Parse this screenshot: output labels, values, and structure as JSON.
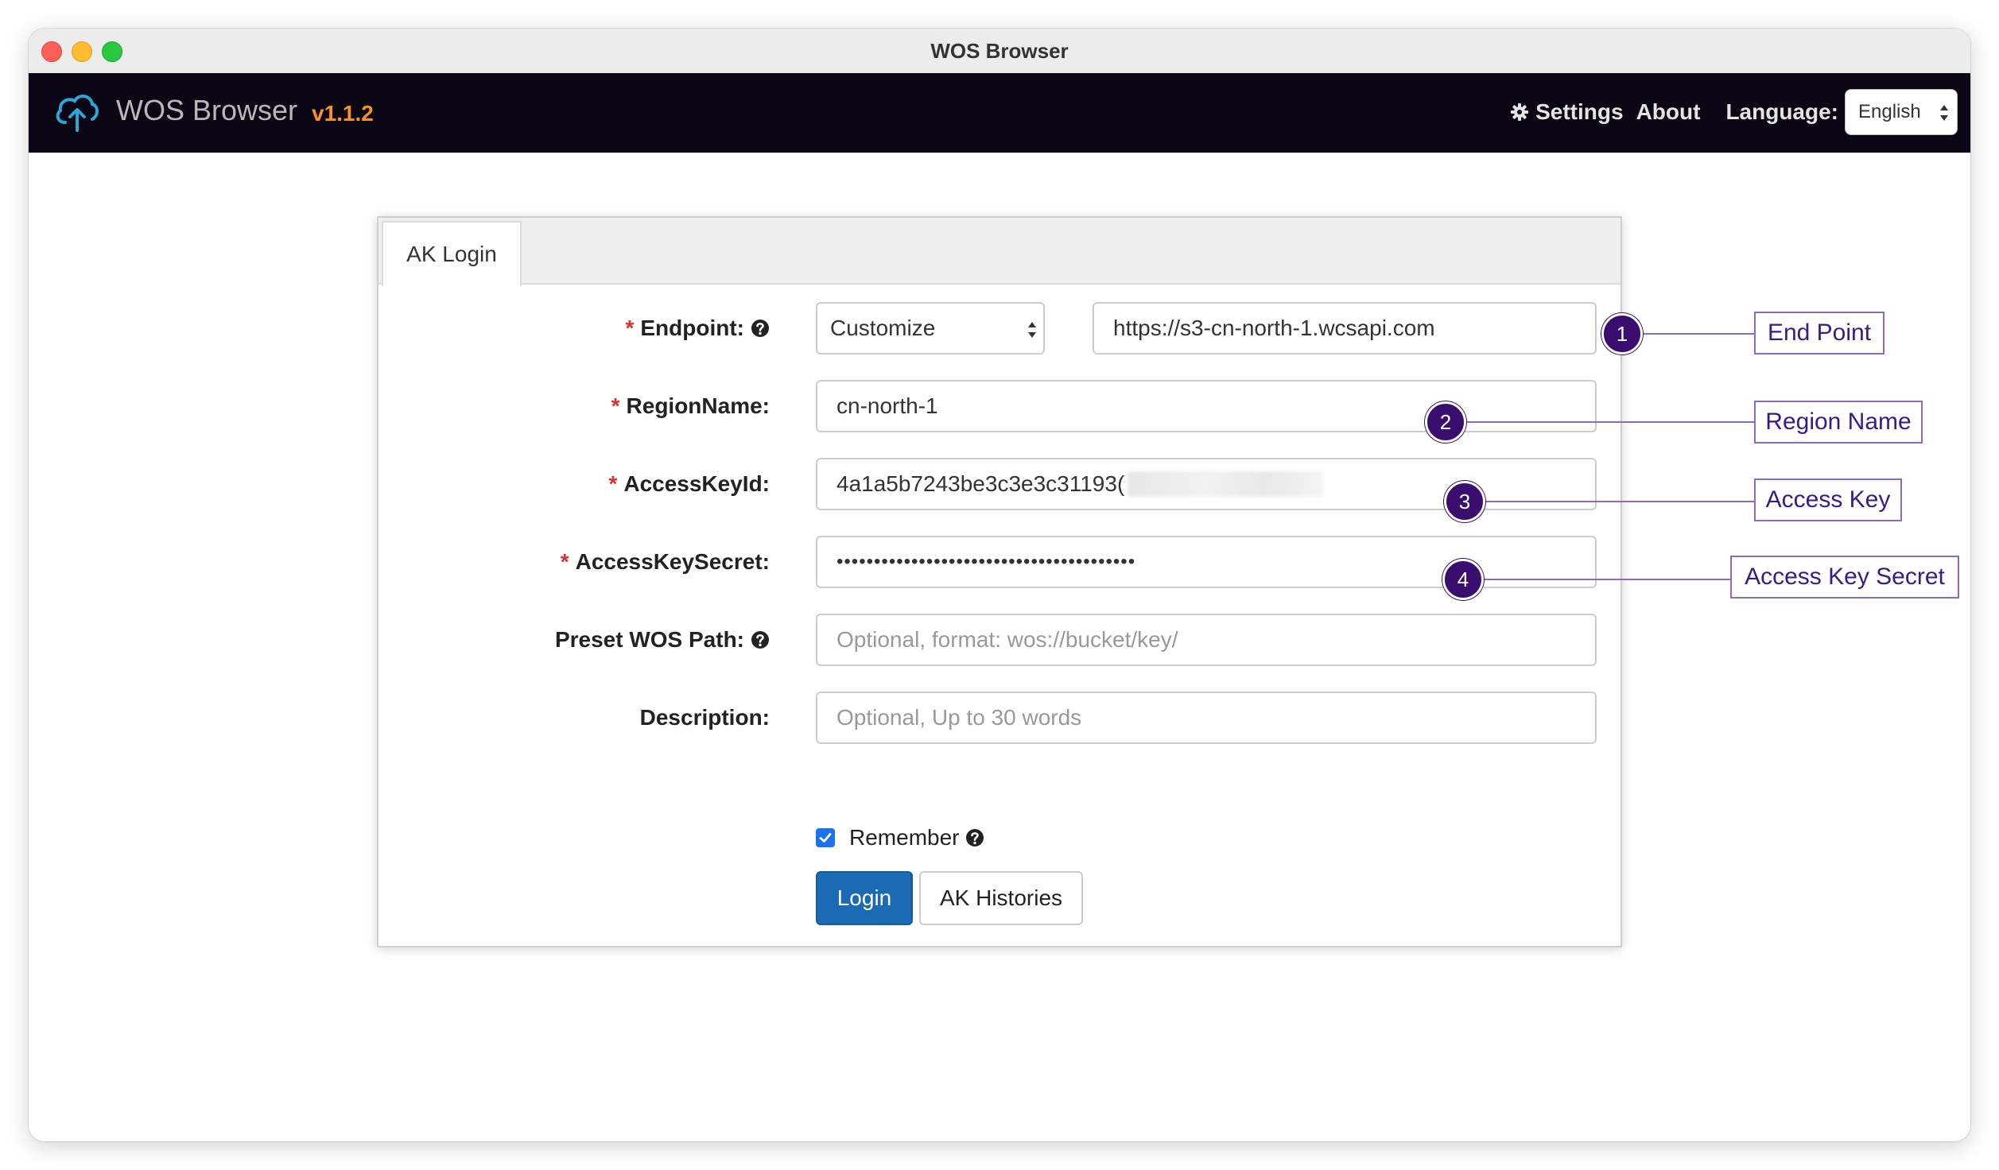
{
  "window": {
    "title": "WOS Browser"
  },
  "navbar": {
    "brand": "WOS Browser",
    "version": "v1.1.2",
    "settings_label": "Settings",
    "about_label": "About",
    "language_label": "Language:",
    "language_value": "English",
    "brand_icon": "cloud-upload-icon"
  },
  "login": {
    "tab_label": "AK Login",
    "endpoint": {
      "label": "Endpoint:",
      "type_value": "Customize",
      "url_value": "https://s3-cn-north-1.wcsapi.com"
    },
    "region": {
      "label": "RegionName:",
      "value": "cn-north-1"
    },
    "access_key_id": {
      "label": "AccessKeyId:",
      "value": "4a1a5b7243be3c3e3c31193("
    },
    "access_key_secret": {
      "label": "AccessKeySecret:",
      "value": "••••••••••••••••••••••••••••••••••••••••"
    },
    "preset_path": {
      "label": "Preset WOS Path:",
      "placeholder": "Optional, format: wos://bucket/key/"
    },
    "description": {
      "label": "Description:",
      "placeholder": "Optional, Up to 30 words"
    },
    "remember_label": "Remember",
    "remember_checked": true,
    "login_button": "Login",
    "histories_button": "AK Histories",
    "required_marker": "*"
  },
  "callouts": [
    {
      "number": "1",
      "label": "End Point"
    },
    {
      "number": "2",
      "label": "Region Name"
    },
    {
      "number": "3",
      "label": "Access Key"
    },
    {
      "number": "4",
      "label": "Access Key Secret"
    }
  ],
  "colors": {
    "navbar_bg": "#0b0614",
    "version": "#f7941d",
    "primary_button": "#1b6ab3",
    "callout_accent": "#3a0e6e",
    "required": "#d9302c"
  }
}
